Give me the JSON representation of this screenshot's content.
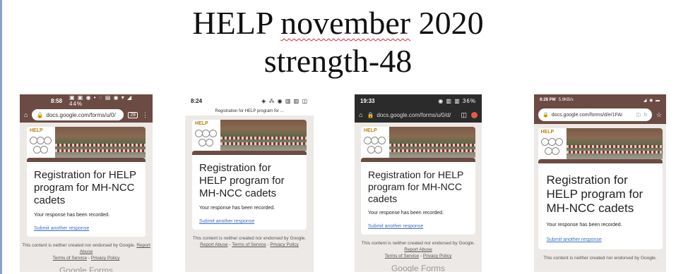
{
  "slide": {
    "title_line1_a": "HELP ",
    "title_line1_b": "november",
    "title_line1_c": " 2020",
    "title_line2": "strength-48"
  },
  "shots": [
    {
      "status_time": "8:58",
      "status_icons": "▣ ▣ ◉ •   ◌ ▤ ◉ ▾ ◢ 44%",
      "url": "docs.google.com/forms/u/0/",
      "tab_count": "28",
      "form_title": "Registration for HELP program for MH-NCC cadets",
      "recorded": "Your response has been recorded.",
      "another": "Submit another response",
      "footer_text": "This content is neither created nor endorsed by Google.",
      "footer_links": [
        "Report Abuse",
        "Terms of Service",
        "Privacy Policy"
      ],
      "brand_a": "Google",
      "brand_b": "Forms"
    },
    {
      "status_time": "8:24",
      "status_icons": "◈ ⁂ ◉ ▥ ▥ ◫",
      "header_text": "Registration for HELP program for ...",
      "form_title": "Registration for HELP program for MH-NCC cadets",
      "recorded": "Your response has been recorded.",
      "another": "Submit another response",
      "footer_text": "This content is neither created nor endorsed by Google.",
      "footer_links": [
        "Report Abuse",
        "Terms of Service",
        "Privacy Policy"
      ]
    },
    {
      "status_time": "19:33",
      "status_icons": "◉ ▥ ▥ 36%",
      "url": "docs.google.com/forms/u/0/d/",
      "form_title": "Registration for HELP program for MH-NCC cadets",
      "recorded": "Your response has been recorded.",
      "another": "Submit another response",
      "footer_text": "This content is neither created nor endorsed by Google.",
      "footer_links": [
        "Report Abuse",
        "Terms of Service",
        "Privacy Policy"
      ],
      "brand_a": "Google",
      "brand_b": "Forms"
    },
    {
      "status_time": "8:28 PM",
      "status_speed": "5.9KB/s",
      "status_icons": "◢ ◉ ▬",
      "url": "docs.google.com/forms/d/e/1FAI",
      "form_title": "Registration for HELP program for MH-NCC cadets",
      "recorded": "Your response has been recorded.",
      "another": "Submit another response",
      "footer_text": "This content is neither created nor endorsed by Google."
    }
  ],
  "banner": {
    "logo_text": "HELP"
  },
  "colors": {
    "accent": "#6b4b43",
    "link": "#3a6fc4",
    "dark_bar": "#2b2b2b"
  }
}
